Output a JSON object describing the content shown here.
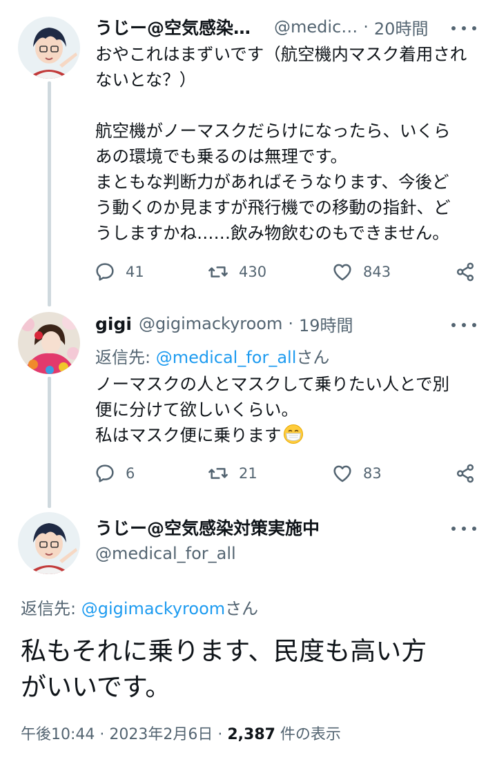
{
  "colors": {
    "link": "#1d9bf0",
    "secondary": "#536471",
    "text": "#0f1419",
    "thread_line": "#cfd9de"
  },
  "tweet1": {
    "name": "うじー@空気感染…",
    "handle": "@medic…",
    "time": "20時間",
    "text": "おやこれはまずいです（航空機内マスク着用され\nないとな？）\n\n航空機がノーマスクだらけになったら、いくら\nあの環境でも乗るのは無理です。\nまともな判断力があればそうなります、今後ど\nう動くのか見ますが飛行機での移動の指針、ど\nうしますかね……飲み物飲むのもできません。",
    "replies": "41",
    "retweets": "430",
    "likes": "843"
  },
  "tweet2": {
    "name": "gigi",
    "handle": "@gigimackyroom",
    "time": "19時間",
    "reply_label": "返信先: ",
    "reply_mention": "@medical_for_all",
    "reply_suffix": "さん",
    "text": "ノーマスクの人とマスクして乗りたい人とで別\n便に分けて欲しいくらい。\n私はマスク便に乗ります",
    "emoji": "mask-face-emoji",
    "replies": "6",
    "retweets": "21",
    "likes": "83"
  },
  "main_tweet": {
    "name": "うじー@空気感染対策実施中",
    "handle": "@medical_for_all",
    "reply_label": "返信先: ",
    "reply_mention": "@gigimackyroom",
    "reply_suffix": "さん",
    "text": "私もそれに乗ります、民度も高い方\nがいいです。",
    "timestamp": "午後10:44 · 2023年2月6日 · ",
    "views_count": "2,387",
    "views_label": " 件の表示"
  },
  "icons": [
    "reply-icon",
    "retweet-icon",
    "like-icon",
    "share-icon",
    "more-icon",
    "mask-face-emoji"
  ]
}
